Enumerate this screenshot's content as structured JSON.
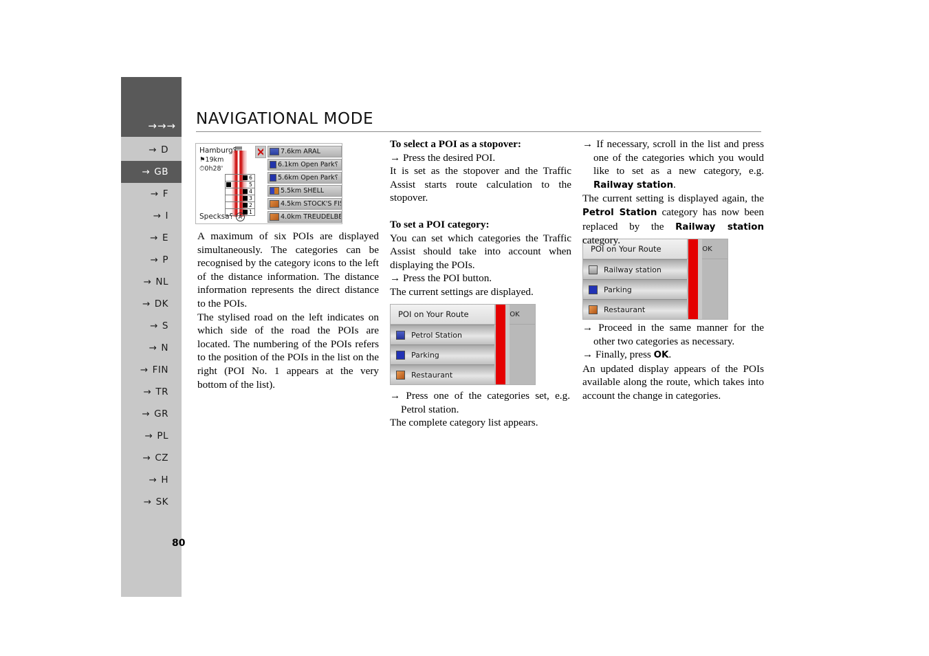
{
  "header": {
    "arrows": "→→→",
    "title": "NAVIGATIONAL MODE"
  },
  "sidebar": {
    "items": [
      {
        "label": "D",
        "active": false
      },
      {
        "label": "GB",
        "active": true
      },
      {
        "label": "F",
        "active": false
      },
      {
        "label": "I",
        "active": false
      },
      {
        "label": "E",
        "active": false
      },
      {
        "label": "P",
        "active": false
      },
      {
        "label": "NL",
        "active": false
      },
      {
        "label": "DK",
        "active": false
      },
      {
        "label": "S",
        "active": false
      },
      {
        "label": "N",
        "active": false
      },
      {
        "label": "FIN",
        "active": false
      },
      {
        "label": "TR",
        "active": false
      },
      {
        "label": "GR",
        "active": false
      },
      {
        "label": "PL",
        "active": false
      },
      {
        "label": "CZ",
        "active": false
      },
      {
        "label": "H",
        "active": false
      },
      {
        "label": "SK",
        "active": false
      }
    ],
    "arrow_glyph": "→"
  },
  "page_number": "80",
  "nav_screenshot": {
    "city": "Hamburg⸮",
    "distance": "19km",
    "time": "0h28'",
    "destination": "Specksa⸮",
    "roundabout_glyph": "A",
    "road_markers": [
      {
        "number": "6",
        "side": "right"
      },
      {
        "number": "5",
        "side": "left"
      },
      {
        "number": "4",
        "side": "right"
      },
      {
        "number": "3",
        "side": "right"
      },
      {
        "number": "2",
        "side": "right"
      },
      {
        "number": "1",
        "side": "right"
      }
    ],
    "poi_list": [
      {
        "icon": "ic-aral",
        "text": "7.6km ARAL"
      },
      {
        "icon": "ic-park",
        "text": "6.1km Open Park⸮"
      },
      {
        "icon": "ic-park",
        "text": "5.6km Open Park⸮"
      },
      {
        "icon": "ic-shell",
        "text": "5.5km SHELL"
      },
      {
        "icon": "ic-rest",
        "text": "4.5km STOCK'S FIS⸮"
      },
      {
        "icon": "ic-rest",
        "text": "4.0km TREUDELBE⸮"
      }
    ]
  },
  "dialog1": {
    "title": "POI on Your Route",
    "ok_label": "OK",
    "items": [
      {
        "icon": "cic-petrol",
        "label": "Petrol Station"
      },
      {
        "icon": "cic-parking",
        "label": "Parking"
      },
      {
        "icon": "cic-rest",
        "label": "Restaurant"
      }
    ]
  },
  "dialog2": {
    "title": "POI on Your Route",
    "ok_label": "OK",
    "items": [
      {
        "icon": "cic-rail",
        "label": "Railway station"
      },
      {
        "icon": "cic-parking",
        "label": "Parking"
      },
      {
        "icon": "cic-rest",
        "label": "Restaurant"
      }
    ]
  },
  "col1": {
    "para1": "A maximum of six POIs are displayed simultaneously. The categories can be recognised by the category icons to the left of the distance information. The distance information represents the direct distance to the POIs.",
    "para2": "The stylised road on the left indicates on which side of the road the POIs are located. The numbering of the POIs refers to the position of the POIs in the list on the right (POI No. 1 appears at the very bottom of the list)."
  },
  "col2a": {
    "heading1": "To select a POI as a stopover:",
    "step1": "→ Press the desired POI.",
    "para1": "It is set as the stopover and the Traffic Assist starts route calculation to the stopover.",
    "heading2": "To set a POI category:",
    "para2": "You can set which categories the Traffic Assist should take into account when displaying the POIs.",
    "step2": "→ Press the POI button.",
    "para3": "The current settings are displayed."
  },
  "col2b": {
    "step1": "→ Press one of the categories set, e.g. Petrol station.",
    "para1": "The complete category list appears."
  },
  "col3a": {
    "step1_pre": "→ If necessary, scroll in the list and press one of the categories which you would like to set as a new category, e.g. ",
    "step1_bold": "Railway station",
    "step1_post": ".",
    "para1_pre": "The current setting is displayed again, the ",
    "para1_bold1": "Petrol Station",
    "para1_mid": " category has now been replaced by the ",
    "para1_bold2": "Railway station",
    "para1_post": " category."
  },
  "col3b": {
    "step1": "→ Proceed in the same manner for the other two categories as necessary.",
    "step2_pre": "→ Finally, press ",
    "step2_bold": "OK",
    "step2_post": ".",
    "para1": "An updated display appears of the POIs available along the route, which takes into account the change in categories."
  }
}
